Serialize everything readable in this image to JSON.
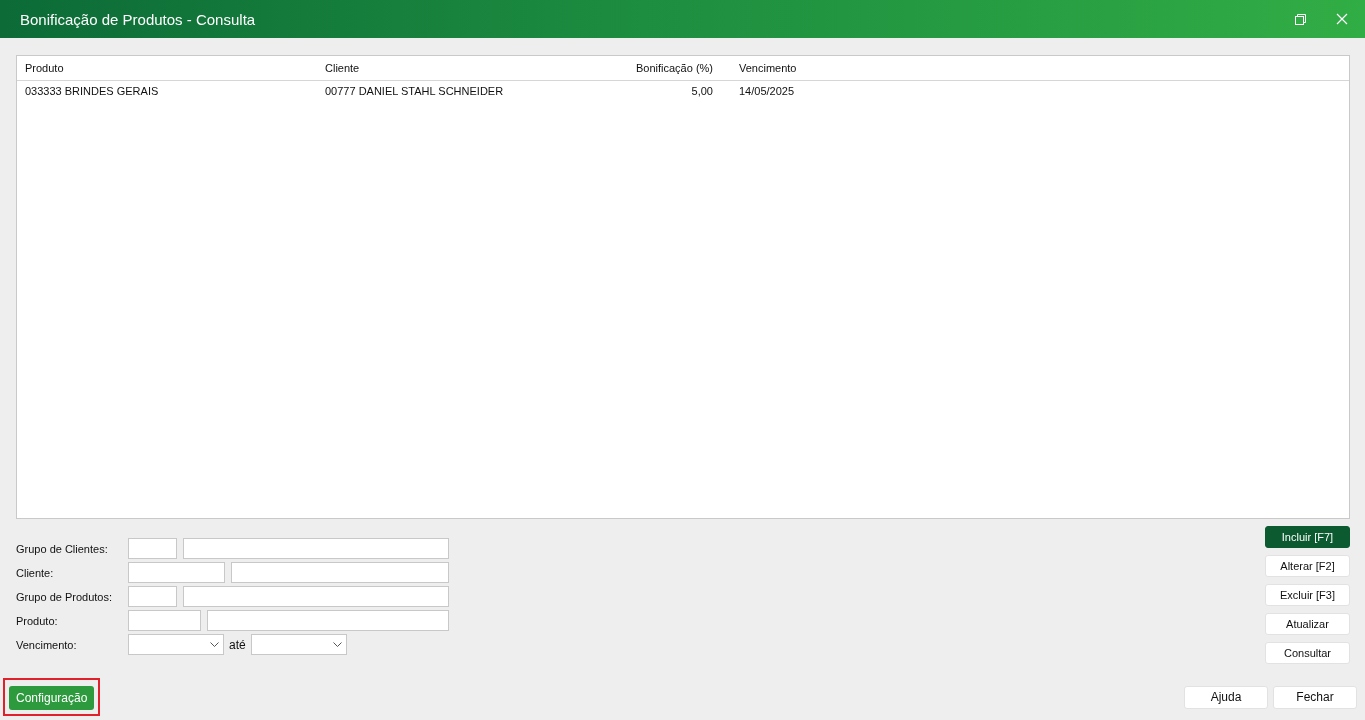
{
  "window": {
    "title": "Bonificação de Produtos - Consulta"
  },
  "table": {
    "columns": [
      {
        "label": "Produto",
        "kind": "text"
      },
      {
        "label": "Cliente",
        "kind": "text"
      },
      {
        "label": "Bonificação (%)",
        "kind": "number"
      },
      {
        "label": "Vencimento",
        "kind": "date"
      }
    ],
    "rows": [
      [
        "033333 BRINDES GERAIS",
        "00777 DANIEL STAHL SCHNEIDER",
        "5,00",
        "14/05/2025"
      ]
    ]
  },
  "filters": [
    {
      "label": "Grupo de Clientes:",
      "kind": "short-code"
    },
    {
      "label": "Cliente:",
      "kind": "long-code"
    },
    {
      "label": "Grupo de Produtos:",
      "kind": "short-code"
    },
    {
      "label": "Produto:",
      "kind": "mid-code"
    },
    {
      "label": "Vencimento:",
      "kind": "date-range",
      "separator": "até"
    }
  ],
  "actions": [
    {
      "label": "Incluir [F7]",
      "kind": "primary"
    },
    {
      "label": "Alterar [F2]",
      "kind": "default"
    },
    {
      "label": "Excluir [F3]",
      "kind": "default"
    },
    {
      "label": "Atualizar",
      "kind": "default"
    },
    {
      "label": "Consultar",
      "kind": "default"
    }
  ],
  "config_button": {
    "label": "Configuração",
    "highlighted": true
  },
  "footer_buttons": [
    "Ajuda",
    "Fechar"
  ]
}
